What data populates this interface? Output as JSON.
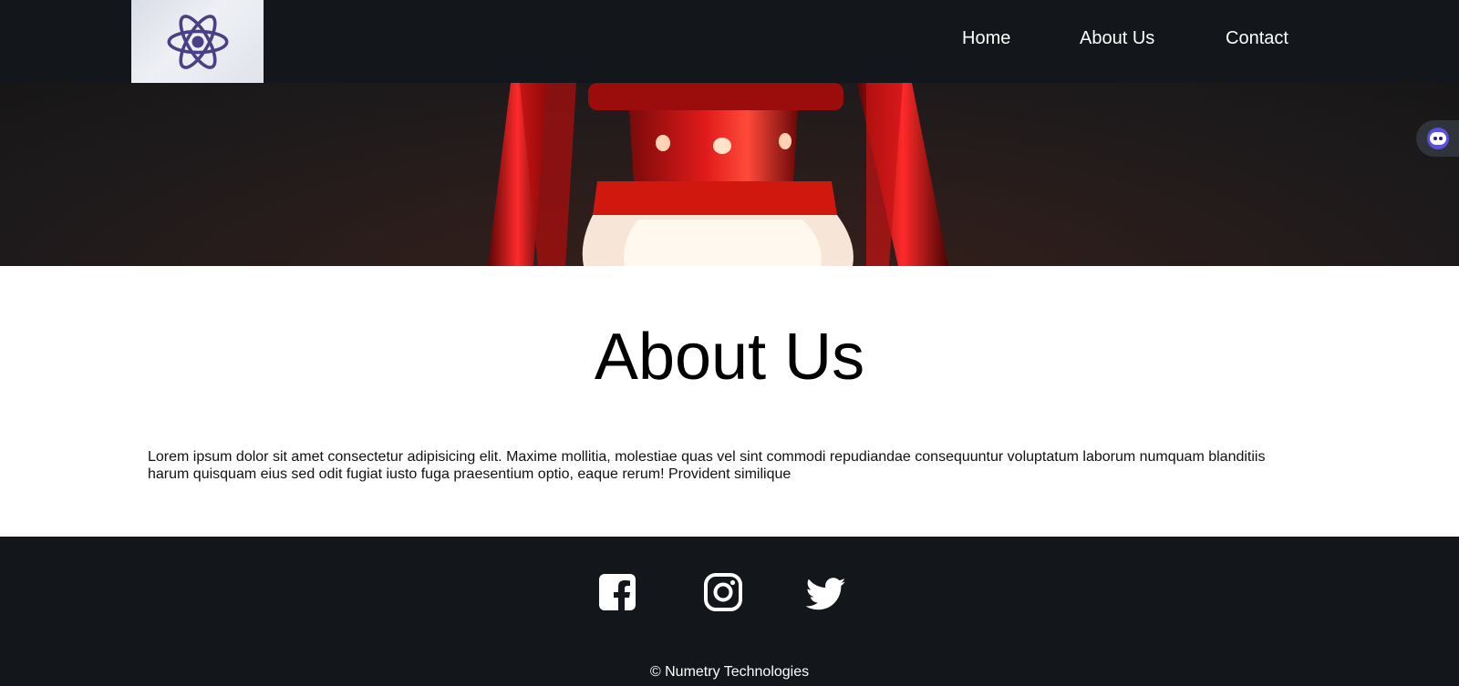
{
  "header": {
    "logo_icon": "react-atom-logo",
    "nav": [
      {
        "label": "Home"
      },
      {
        "label": "About Us"
      },
      {
        "label": "Contact"
      }
    ]
  },
  "hero": {
    "image": "red-lantern-photo"
  },
  "side_widget": {
    "icon": "assistant-face-icon"
  },
  "main": {
    "title": "About Us",
    "text": "Lorem ipsum dolor sit amet consectetur adipisicing elit. Maxime mollitia, molestiae quas vel sint commodi repudiandae consequuntur voluptatum laborum numquam blanditiis harum quisquam eius sed odit fugiat iusto fuga praesentium optio, eaque rerum! Provident similique"
  },
  "footer": {
    "social": [
      {
        "icon": "facebook-icon"
      },
      {
        "icon": "instagram-icon"
      },
      {
        "icon": "twitter-icon"
      }
    ],
    "copyright": "© Numetry Technologies"
  },
  "colors": {
    "header_bg": "#13171b",
    "footer_bg": "#13171b",
    "logo_accent": "#4b3f86",
    "widget_accent": "#5a4fe0"
  }
}
